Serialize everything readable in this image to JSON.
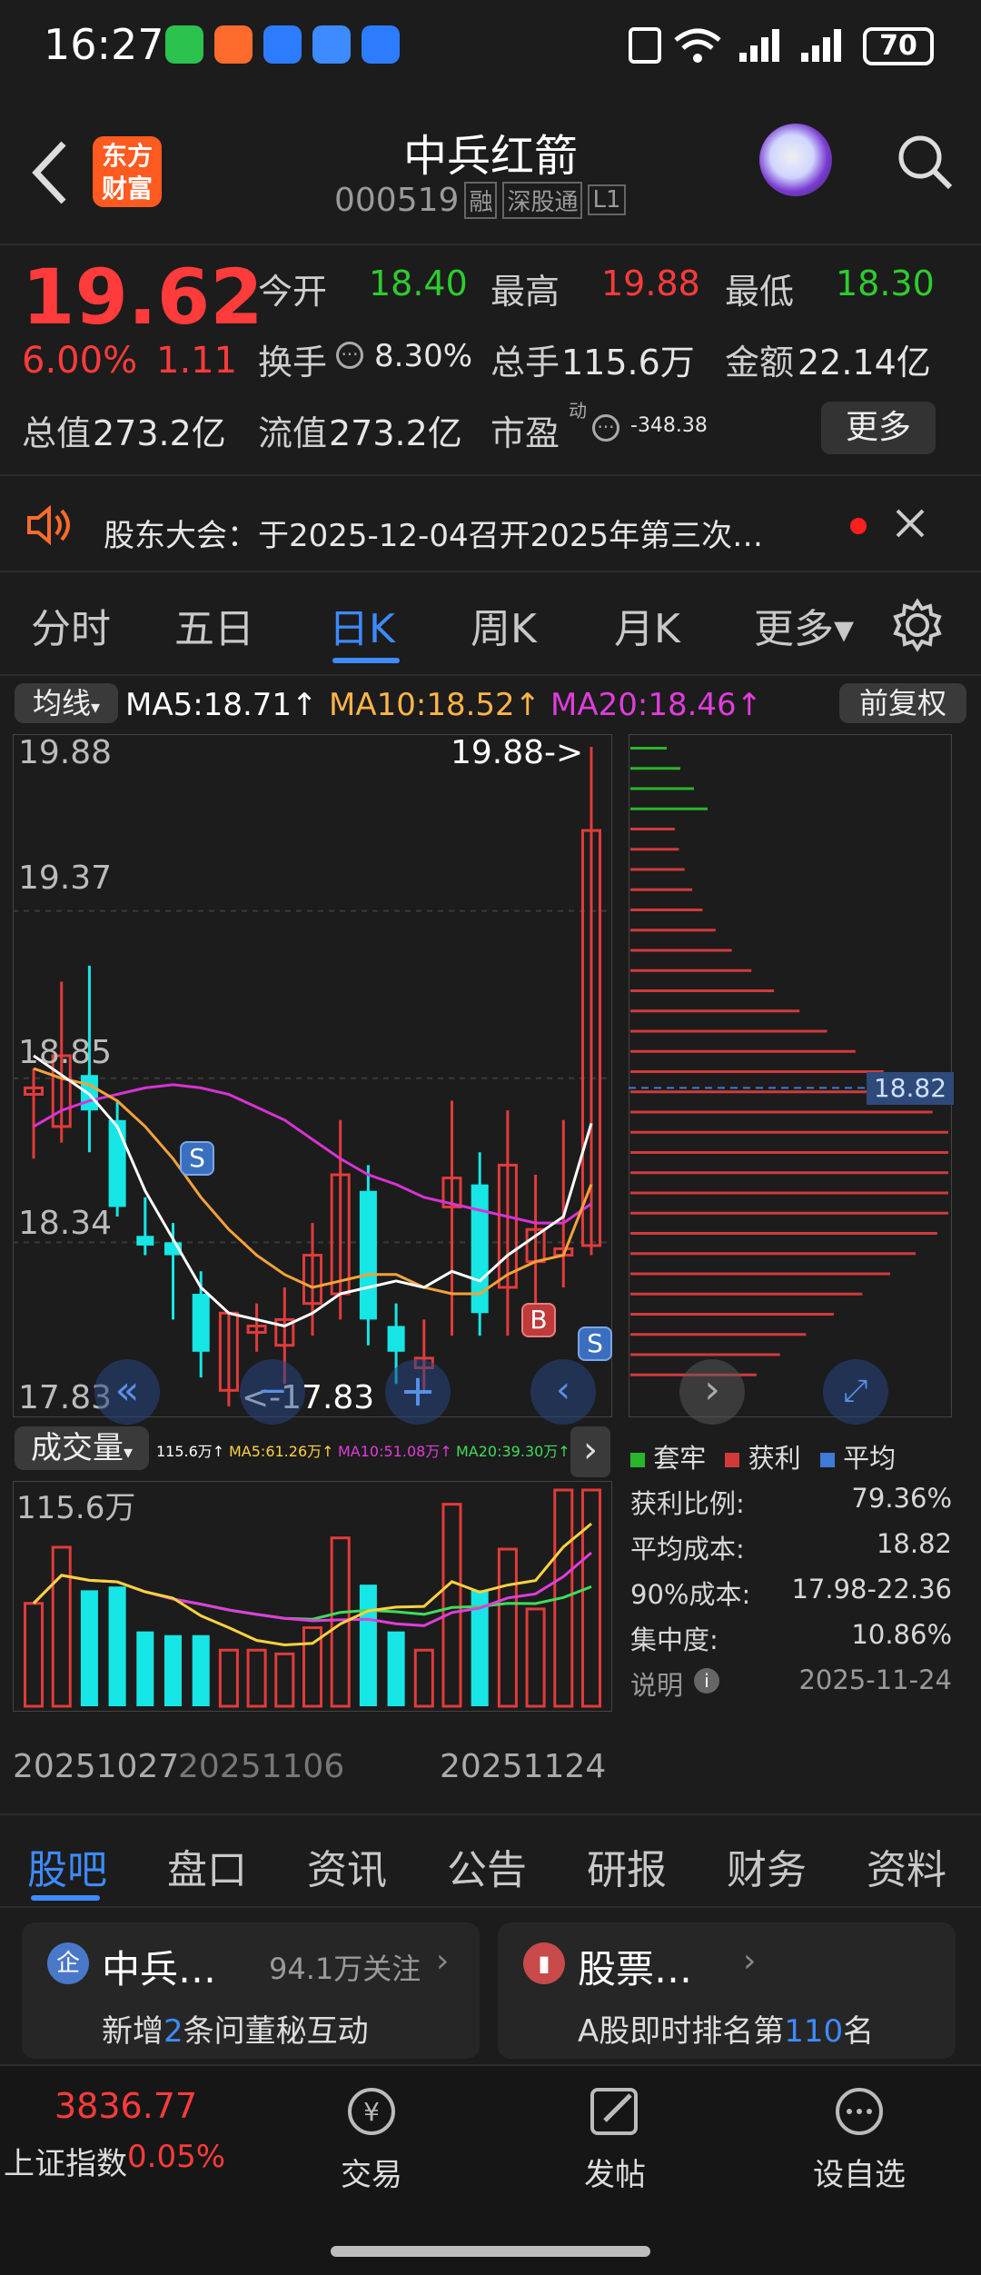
{
  "status": {
    "time": "16:27",
    "battery": "70"
  },
  "header": {
    "title": "中兵红箭",
    "code": "000519",
    "tags": [
      "融",
      "深股通",
      "L1"
    ],
    "logo_line1": "东方",
    "logo_line2": "财富"
  },
  "quote": {
    "price": "19.62",
    "change_pct": "6.00%",
    "change_amt": "1.11",
    "open_label": "今开",
    "open": "18.40",
    "high_label": "最高",
    "high": "19.88",
    "low_label": "最低",
    "low": "18.30",
    "turnover_label": "换手",
    "turnover": "8.30%",
    "volume_label": "总手",
    "volume": "115.6万",
    "amount_label": "金额",
    "amount": "22.14亿",
    "mktcap_label": "总值",
    "mktcap": "273.2亿",
    "float_label": "流值",
    "float": "273.2亿",
    "pe_label": "市盈",
    "pe_sup": "动",
    "pe": "-348.38",
    "more_btn": "更多"
  },
  "notice": {
    "text": "股东大会：于2025-12-04召开2025年第三次…"
  },
  "period_tabs": [
    "分时",
    "五日",
    "日K",
    "周K",
    "月K",
    "更多▾"
  ],
  "active_period": 2,
  "ma_bar": {
    "selector": "均线",
    "ma5": "MA5:18.71↑",
    "ma10": "MA10:18.52↑",
    "ma20": "MA20:18.46↑",
    "adjust": "前复权"
  },
  "kline": {
    "y_labels": [
      "19.88",
      "19.37",
      "18.85",
      "18.34",
      "17.83"
    ],
    "max_note": "19.88->",
    "min_note": "<-17.83",
    "cost_tag": "18.82",
    "marker_s1": "S",
    "marker_s2": "S",
    "marker_b": "B"
  },
  "chart_data": {
    "type": "candlestick",
    "ylim": [
      17.83,
      19.88
    ],
    "candles": [
      {
        "o": 18.8,
        "h": 18.88,
        "l": 18.6,
        "c": 18.82
      },
      {
        "o": 18.7,
        "h": 19.15,
        "l": 18.65,
        "c": 18.92
      },
      {
        "o": 18.86,
        "h": 19.2,
        "l": 18.62,
        "c": 18.75
      },
      {
        "o": 18.72,
        "h": 18.78,
        "l": 18.42,
        "c": 18.45
      },
      {
        "o": 18.36,
        "h": 18.48,
        "l": 18.3,
        "c": 18.33
      },
      {
        "o": 18.34,
        "h": 18.4,
        "l": 18.1,
        "c": 18.3
      },
      {
        "o": 18.18,
        "h": 18.25,
        "l": 17.92,
        "c": 18.0
      },
      {
        "o": 17.88,
        "h": 18.12,
        "l": 17.83,
        "c": 18.12
      },
      {
        "o": 18.06,
        "h": 18.15,
        "l": 18.0,
        "c": 18.08
      },
      {
        "o": 18.02,
        "h": 18.2,
        "l": 17.9,
        "c": 18.1
      },
      {
        "o": 18.15,
        "h": 18.4,
        "l": 18.05,
        "c": 18.3
      },
      {
        "o": 18.18,
        "h": 18.72,
        "l": 18.1,
        "c": 18.55
      },
      {
        "o": 18.5,
        "h": 18.58,
        "l": 18.02,
        "c": 18.1
      },
      {
        "o": 18.08,
        "h": 18.15,
        "l": 17.9,
        "c": 18.0
      },
      {
        "o": 17.95,
        "h": 18.1,
        "l": 17.88,
        "c": 17.98
      },
      {
        "o": 18.45,
        "h": 18.78,
        "l": 18.05,
        "c": 18.54
      },
      {
        "o": 18.52,
        "h": 18.62,
        "l": 18.05,
        "c": 18.12
      },
      {
        "o": 18.2,
        "h": 18.75,
        "l": 18.05,
        "c": 18.58
      },
      {
        "o": 18.28,
        "h": 18.55,
        "l": 18.05,
        "c": 18.38
      },
      {
        "o": 18.3,
        "h": 18.72,
        "l": 18.2,
        "c": 18.32
      },
      {
        "o": 18.33,
        "h": 19.88,
        "l": 18.3,
        "c": 19.62
      }
    ],
    "ma5": [
      18.92,
      18.86,
      18.8,
      18.7,
      18.5,
      18.35,
      18.2,
      18.12,
      18.1,
      18.08,
      18.12,
      18.18,
      18.2,
      18.22,
      18.2,
      18.25,
      18.22,
      18.3,
      18.36,
      18.42,
      18.71
    ],
    "ma10": [
      18.88,
      18.85,
      18.83,
      18.78,
      18.7,
      18.6,
      18.48,
      18.38,
      18.3,
      18.24,
      18.2,
      18.22,
      18.24,
      18.24,
      18.2,
      18.18,
      18.18,
      18.24,
      18.28,
      18.3,
      18.52
    ],
    "ma20": [
      18.7,
      18.75,
      18.78,
      18.8,
      18.82,
      18.83,
      18.82,
      18.8,
      18.76,
      18.72,
      18.66,
      18.6,
      18.55,
      18.52,
      18.48,
      18.46,
      18.44,
      18.42,
      18.4,
      18.4,
      18.46
    ],
    "volume": [
      55,
      85,
      62,
      64,
      40,
      38,
      38,
      30,
      30,
      28,
      42,
      90,
      65,
      40,
      30,
      108,
      62,
      84,
      52,
      120,
      170
    ],
    "vol_ylim": [
      0,
      115.6
    ]
  },
  "volume_bar": {
    "selector": "成交量",
    "vol": "115.6万↑",
    "ma5": "MA5:61.26万↑",
    "ma10": "MA10:51.08万↑",
    "ma20": "MA20:39.30万↑",
    "max_label": "115.6万"
  },
  "dates": [
    "20251027",
    "20251106",
    "20251124"
  ],
  "chips": {
    "legend": [
      "套牢",
      "获利",
      "平均"
    ],
    "rows": [
      {
        "label": "获利比例:",
        "value": "79.36%"
      },
      {
        "label": "平均成本:",
        "value": "18.82"
      },
      {
        "label": "90%成本:",
        "value": "17.98-22.36"
      },
      {
        "label": "集中度:",
        "value": "10.86%"
      }
    ],
    "note_label": "说明",
    "note_date": "2025-11-24"
  },
  "info_tabs": [
    "股吧",
    "盘口",
    "资讯",
    "公告",
    "研报",
    "财务",
    "资料"
  ],
  "cards": [
    {
      "title": "中兵…",
      "meta": "94.1万关注",
      "line_pre": "新增",
      "line_num": "2",
      "line_post": "条问董秘互动"
    },
    {
      "title": "股票…",
      "meta": "",
      "line_pre": "A股即时排名第",
      "line_num": "110",
      "line_post": "名"
    }
  ],
  "bottom": {
    "index_value": "3836.77",
    "index_name": "上证指数",
    "index_change": "0.05%",
    "trade": "交易",
    "post": "发帖",
    "watch": "设自选"
  }
}
